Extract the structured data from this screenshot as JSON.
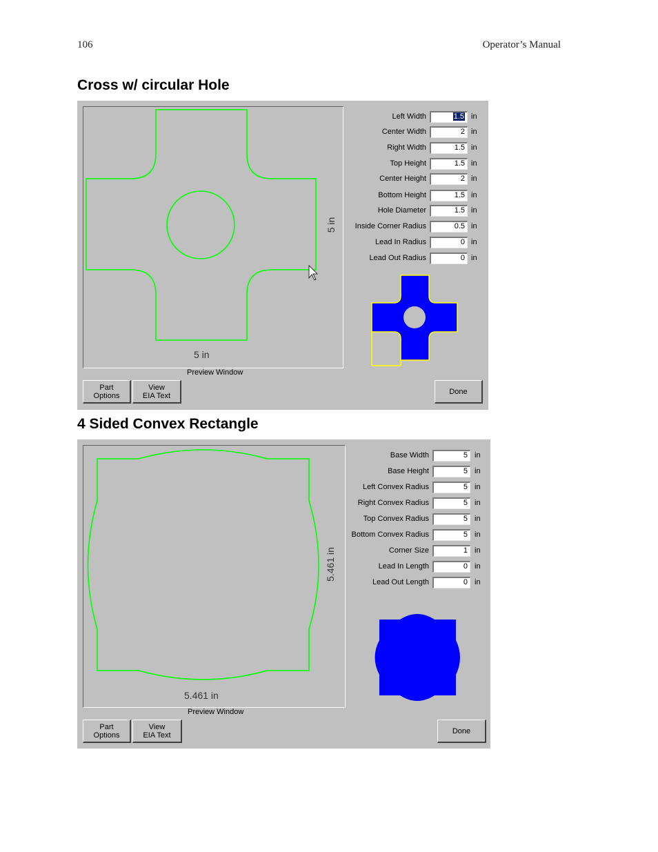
{
  "header": {
    "page_number": "106",
    "manual_title": "Operator’s Manual"
  },
  "colors": {
    "dialog_bg": "#c0c0c0",
    "outline_green": "#00ff00",
    "thumb_blue": "#0000ff",
    "thumb_yellow": "#ffff00"
  },
  "sections": [
    {
      "heading": "Cross w/ circular Hole",
      "preview": {
        "width_dim": "5 in",
        "height_dim": "5 in",
        "caption": "Preview Window"
      },
      "fields": [
        {
          "label": "Left Width",
          "value": "1.5",
          "unit": "in",
          "selected": true
        },
        {
          "label": "Center Width",
          "value": "2",
          "unit": "in"
        },
        {
          "label": "Right Width",
          "value": "1.5",
          "unit": "in"
        },
        {
          "label": "Top Height",
          "value": "1.5",
          "unit": "in"
        },
        {
          "label": "Center Height",
          "value": "2",
          "unit": "in"
        },
        {
          "label": "Bottom Height",
          "value": "1.5",
          "unit": "in"
        },
        {
          "label": "Hole Diameter",
          "value": "1.5",
          "unit": "in"
        },
        {
          "label": "Inside Corner Radius",
          "value": "0.5",
          "unit": "in"
        },
        {
          "label": "Lead In Radius",
          "value": "0",
          "unit": "in"
        },
        {
          "label": "Lead Out Radius",
          "value": "0",
          "unit": "in"
        }
      ],
      "buttons": {
        "part_options": [
          "Part",
          "Options"
        ],
        "view_eia": [
          "View",
          "EIA Text"
        ],
        "done": "Done"
      }
    },
    {
      "heading": "4 Sided Convex Rectangle",
      "preview": {
        "width_dim": "5.461 in",
        "height_dim": "5.461 in",
        "caption": "Preview Window"
      },
      "fields": [
        {
          "label": "Base Width",
          "value": "5",
          "unit": "in"
        },
        {
          "label": "Base Height",
          "value": "5",
          "unit": "in"
        },
        {
          "label": "Left Convex Radius",
          "value": "5",
          "unit": "in"
        },
        {
          "label": "Right Convex Radius",
          "value": "5",
          "unit": "in"
        },
        {
          "label": "Top Convex Radius",
          "value": "5",
          "unit": "in"
        },
        {
          "label": "Bottom Convex Radius",
          "value": "5",
          "unit": "in"
        },
        {
          "label": "Corner Size",
          "value": "1",
          "unit": "in"
        },
        {
          "label": "Lead In Length",
          "value": "0",
          "unit": "in"
        },
        {
          "label": "Lead Out Length",
          "value": "0",
          "unit": "in"
        }
      ],
      "buttons": {
        "part_options": [
          "Part",
          "Options"
        ],
        "view_eia": [
          "View",
          "EIA Text"
        ],
        "done": "Done"
      }
    }
  ]
}
